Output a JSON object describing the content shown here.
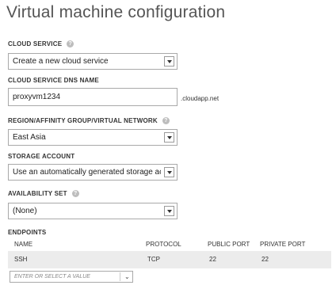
{
  "page_title": "Virtual machine configuration",
  "cloud_service": {
    "label": "CLOUD SERVICE",
    "value": "Create a new cloud service"
  },
  "dns_name": {
    "label": "CLOUD SERVICE DNS NAME",
    "value": "proxyvm1234",
    "suffix": ".cloudapp.net"
  },
  "region": {
    "label": "REGION/AFFINITY GROUP/VIRTUAL NETWORK",
    "value": "East Asia"
  },
  "storage": {
    "label": "STORAGE ACCOUNT",
    "value": "Use an automatically generated storage account"
  },
  "availability": {
    "label": "AVAILABILITY SET",
    "value": "(None)"
  },
  "endpoints": {
    "label": "ENDPOINTS",
    "columns": [
      "NAME",
      "PROTOCOL",
      "PUBLIC PORT",
      "PRIVATE PORT"
    ],
    "rows": [
      {
        "name": "SSH",
        "protocol": "TCP",
        "public_port": "22",
        "private_port": "22"
      }
    ],
    "add_placeholder": "ENTER OR SELECT A VALUE"
  },
  "icons": {
    "help": "question-icon",
    "dropdown": "chevron-down-icon"
  },
  "colors": {
    "row_bg": "#ececec",
    "help_bg": "#bdbdbd",
    "title": "#555555"
  }
}
